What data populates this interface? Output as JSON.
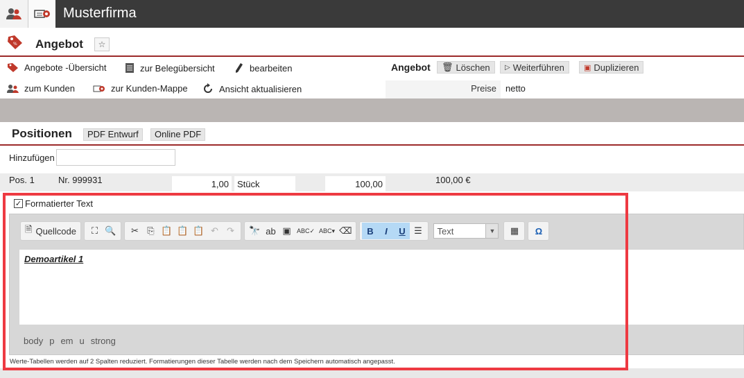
{
  "topbar": {
    "title": "Musterfirma"
  },
  "page": {
    "title": "Angebot"
  },
  "nav": {
    "offers_overview": "Angebote -Übersicht",
    "documents_overview": "zur Belegübersicht",
    "edit": "bearbeiten",
    "to_customer": "zum Kunden",
    "customer_folder": "zur Kunden-Mappe",
    "refresh": "Ansicht aktualisieren"
  },
  "actions": {
    "header": "Angebot",
    "delete": "Löschen",
    "continue": "Weiterführen",
    "duplicate": "Duplizieren"
  },
  "prices": {
    "label": "Preise",
    "value": "netto"
  },
  "positions": {
    "title": "Positionen",
    "pdf_draft": "PDF Entwurf",
    "online_pdf": "Online PDF",
    "add_label": "Hinzufügen"
  },
  "row": {
    "pos": "Pos. 1",
    "nr": "Nr. 999931",
    "qty": "1,00",
    "unit": "Stück",
    "price": "100,00",
    "total": "100,00 €"
  },
  "editor": {
    "checkbox_label": "Formatierter Text",
    "source_label": "Quellcode",
    "bold": "B",
    "italic": "I",
    "underline": "U",
    "format_value": "Text",
    "content": "Demoartikel 1",
    "path": [
      "body",
      "p",
      "em",
      "u",
      "strong"
    ],
    "footnote": "Werte-Tabellen werden auf 2 Spalten reduziert. Formatierungen dieser Tabelle werden nach dem Speichern automatisch angepasst."
  },
  "colors": {
    "accent": "#9c2a2a",
    "highlight": "#ee3a42",
    "topbar": "#3a3a3a"
  }
}
